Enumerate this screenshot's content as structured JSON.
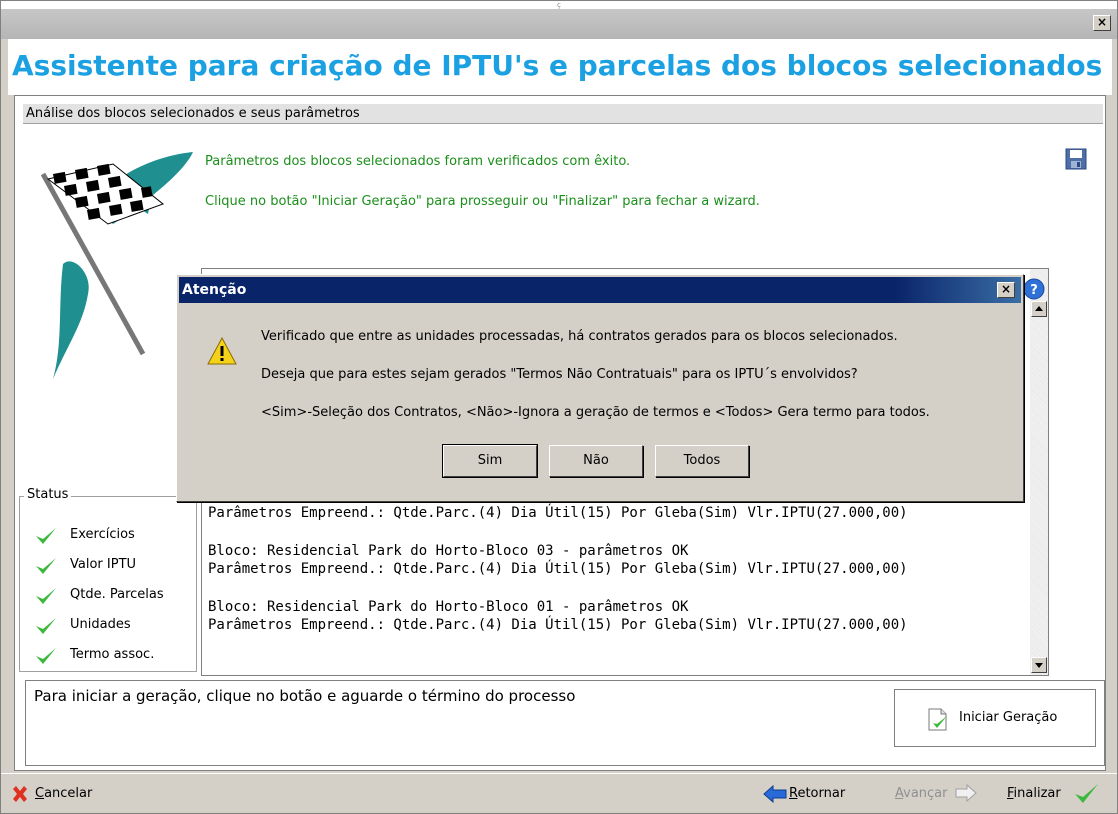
{
  "window": {
    "title_fragment": "ç",
    "close_label": "×"
  },
  "header": {
    "title": "Assistente para criação de IPTU's e parcelas dos blocos selecionados"
  },
  "section": {
    "title": "Análise dos blocos selecionados e seus parâmetros"
  },
  "messages": {
    "success": "Parâmetros dos blocos selecionados foram verificados com êxito.",
    "instruction": "Clique no botão \"Iniciar Geração\" para prosseguir ou \"Finalizar\" para fechar a wizard."
  },
  "status": {
    "title": "Status",
    "items": [
      "Exercícios",
      "Valor IPTU",
      "Qtde. Parcelas",
      "Unidades",
      "Termo assoc."
    ]
  },
  "log": {
    "lines": [
      "Parâmetros Empreend.: Qtde.Parc.(4) Dia Útil(15) Por Gleba(Sim) Vlr.IPTU(27.000,00)",
      "Bloco: Residencial Park do Horto-Bloco 03 - parâmetros OK",
      "Parâmetros Empreend.: Qtde.Parc.(4) Dia Útil(15) Por Gleba(Sim) Vlr.IPTU(27.000,00)",
      "Bloco: Residencial Park do Horto-Bloco 01 - parâmetros OK",
      "Parâmetros Empreend.: Qtde.Parc.(4) Dia Útil(15) Por Gleba(Sim) Vlr.IPTU(27.000,00)"
    ]
  },
  "bottom": {
    "instruction": "Para iniciar a geração, clique no botão e aguarde o término do processo",
    "start_button": "Iniciar Geração"
  },
  "footer": {
    "cancel": "ancelar",
    "cancel_mnemonic": "C",
    "back": "etornar",
    "back_mnemonic": "R",
    "next": "vançar",
    "next_mnemonic": "A",
    "finish": "inalizar",
    "finish_mnemonic": "F"
  },
  "dialog": {
    "title": "Atenção",
    "line1": "Verificado que entre as unidades processadas, há contratos gerados para os blocos selecionados.",
    "line2": "Deseja que para estes sejam gerados \"Termos Não Contratuais\" para os IPTU´s envolvidos?",
    "line3": "<Sim>-Seleção dos Contratos, <Não>-Ignora a geração de termos e <Todos> Gera termo para todos.",
    "yes": "Sim",
    "no": "Não",
    "all": "Todos"
  },
  "colors": {
    "title_blue": "#1ba1e2",
    "success_green": "#1b8f1b",
    "dialog_title_bar": "#0a246a",
    "window_face": "#d4d0c8"
  },
  "icons": [
    "close-icon",
    "checkered-flag-icon",
    "save-icon",
    "check-icon",
    "help-icon",
    "warning-icon",
    "document-check-icon",
    "cancel-x-icon",
    "arrow-left-icon",
    "arrow-right-icon"
  ]
}
